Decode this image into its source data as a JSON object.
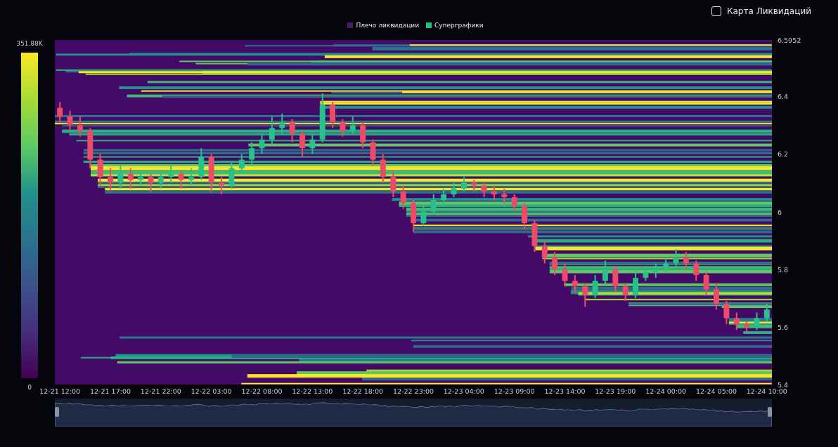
{
  "toggle": {
    "label": "Карта Ликвидаций",
    "checked": false
  },
  "legend": [
    {
      "label": "Плечо ликвидации",
      "color": "#4a1a6b"
    },
    {
      "label": "Суперграфики",
      "color": "#19c37d"
    }
  ],
  "color_scale": {
    "max": "351.88K",
    "min": "0"
  },
  "chart_data": {
    "type": "candlestick",
    "ylim": [
      5.4,
      6.5952
    ],
    "yticks": [
      {
        "value": 6.5952,
        "label": "6.5952"
      },
      {
        "value": 6.4,
        "label": "6.4"
      },
      {
        "value": 6.2,
        "label": "6.2"
      },
      {
        "value": 6,
        "label": "6"
      },
      {
        "value": 5.8,
        "label": "5.8"
      },
      {
        "value": 5.6,
        "label": "5.6"
      },
      {
        "value": 5.4,
        "label": "5.4"
      }
    ],
    "categories": [
      "12-21 12:00",
      null,
      null,
      null,
      null,
      "12-21 17:00",
      null,
      null,
      null,
      null,
      "12-21 22:00",
      null,
      null,
      null,
      null,
      "12-22 03:00",
      null,
      null,
      null,
      null,
      "12-22 08:00",
      null,
      null,
      null,
      null,
      "12-22 13:00",
      null,
      null,
      null,
      null,
      "12-22 18:00",
      null,
      null,
      null,
      null,
      "12-22 23:00",
      null,
      null,
      null,
      null,
      "12-23 04:00",
      null,
      null,
      null,
      null,
      "12-23 09:00",
      null,
      null,
      null,
      null,
      "12-23 14:00",
      null,
      null,
      null,
      null,
      "12-23 19:00",
      null,
      null,
      null,
      null,
      "12-24 00:00",
      null,
      null,
      null,
      null,
      "12-24 05:00",
      null,
      null,
      null,
      null,
      "12-24 10:00"
    ],
    "ohlc": [
      [
        6.36,
        6.38,
        6.31,
        6.33
      ],
      [
        6.33,
        6.35,
        6.28,
        6.3
      ],
      [
        6.3,
        6.33,
        6.26,
        6.28
      ],
      [
        6.28,
        6.29,
        6.15,
        6.18
      ],
      [
        6.18,
        6.2,
        6.09,
        6.12
      ],
      [
        6.12,
        6.15,
        6.07,
        6.1
      ],
      [
        6.1,
        6.16,
        6.08,
        6.13
      ],
      [
        6.13,
        6.15,
        6.08,
        6.11
      ],
      [
        6.11,
        6.14,
        6.09,
        6.12
      ],
      [
        6.12,
        6.13,
        6.07,
        6.1
      ],
      [
        6.1,
        6.14,
        6.08,
        6.12
      ],
      [
        6.12,
        6.16,
        6.1,
        6.13
      ],
      [
        6.13,
        6.14,
        6.08,
        6.11
      ],
      [
        6.11,
        6.15,
        6.09,
        6.12
      ],
      [
        6.12,
        6.22,
        6.11,
        6.19
      ],
      [
        6.19,
        6.2,
        6.07,
        6.1
      ],
      [
        6.1,
        6.12,
        6.06,
        6.09
      ],
      [
        6.09,
        6.17,
        6.08,
        6.15
      ],
      [
        6.15,
        6.2,
        6.13,
        6.18
      ],
      [
        6.18,
        6.24,
        6.16,
        6.22
      ],
      [
        6.22,
        6.27,
        6.2,
        6.25
      ],
      [
        6.25,
        6.33,
        6.23,
        6.29
      ],
      [
        6.29,
        6.34,
        6.27,
        6.31
      ],
      [
        6.31,
        6.32,
        6.24,
        6.27
      ],
      [
        6.27,
        6.28,
        6.19,
        6.22
      ],
      [
        6.22,
        6.27,
        6.2,
        6.25
      ],
      [
        6.25,
        6.41,
        6.24,
        6.37
      ],
      [
        6.37,
        6.38,
        6.29,
        6.31
      ],
      [
        6.31,
        6.32,
        6.26,
        6.28
      ],
      [
        6.28,
        6.33,
        6.27,
        6.3
      ],
      [
        6.3,
        6.31,
        6.22,
        6.24
      ],
      [
        6.24,
        6.25,
        6.16,
        6.18
      ],
      [
        6.18,
        6.2,
        6.1,
        6.12
      ],
      [
        6.12,
        6.14,
        6.05,
        6.07
      ],
      [
        6.07,
        6.09,
        6.01,
        6.03
      ],
      [
        6.03,
        6.04,
        5.93,
        5.96
      ],
      [
        5.96,
        6.02,
        5.95,
        6.0
      ],
      [
        6.0,
        6.06,
        5.99,
        6.04
      ],
      [
        6.04,
        6.08,
        6.02,
        6.06
      ],
      [
        6.06,
        6.1,
        6.05,
        6.08
      ],
      [
        6.08,
        6.12,
        6.07,
        6.1
      ],
      [
        6.1,
        6.11,
        6.07,
        6.09
      ],
      [
        6.09,
        6.1,
        6.05,
        6.07
      ],
      [
        6.07,
        6.09,
        6.04,
        6.06
      ],
      [
        6.06,
        6.08,
        6.03,
        6.05
      ],
      [
        6.05,
        6.06,
        6.0,
        6.02
      ],
      [
        6.02,
        6.03,
        5.94,
        5.96
      ],
      [
        5.96,
        5.97,
        5.86,
        5.88
      ],
      [
        5.88,
        5.9,
        5.82,
        5.84
      ],
      [
        5.84,
        5.86,
        5.78,
        5.8
      ],
      [
        5.8,
        5.82,
        5.74,
        5.76
      ],
      [
        5.76,
        5.78,
        5.72,
        5.74
      ],
      [
        5.74,
        5.75,
        5.67,
        5.71
      ],
      [
        5.71,
        5.78,
        5.7,
        5.76
      ],
      [
        5.76,
        5.83,
        5.75,
        5.8
      ],
      [
        5.8,
        5.81,
        5.72,
        5.74
      ],
      [
        5.74,
        5.75,
        5.69,
        5.71
      ],
      [
        5.71,
        5.79,
        5.7,
        5.77
      ],
      [
        5.77,
        5.81,
        5.76,
        5.79
      ],
      [
        5.79,
        5.82,
        5.77,
        5.8
      ],
      [
        5.8,
        5.84,
        5.79,
        5.82
      ],
      [
        5.82,
        5.87,
        5.81,
        5.84
      ],
      [
        5.84,
        5.86,
        5.8,
        5.82
      ],
      [
        5.82,
        5.83,
        5.76,
        5.78
      ],
      [
        5.78,
        5.79,
        5.71,
        5.73
      ],
      [
        5.73,
        5.75,
        5.66,
        5.68
      ],
      [
        5.68,
        5.69,
        5.61,
        5.63
      ],
      [
        5.63,
        5.65,
        5.59,
        5.61
      ],
      [
        5.61,
        5.62,
        5.58,
        5.6
      ],
      [
        5.6,
        5.65,
        5.59,
        5.63
      ],
      [
        5.63,
        5.68,
        5.62,
        5.66
      ]
    ]
  }
}
